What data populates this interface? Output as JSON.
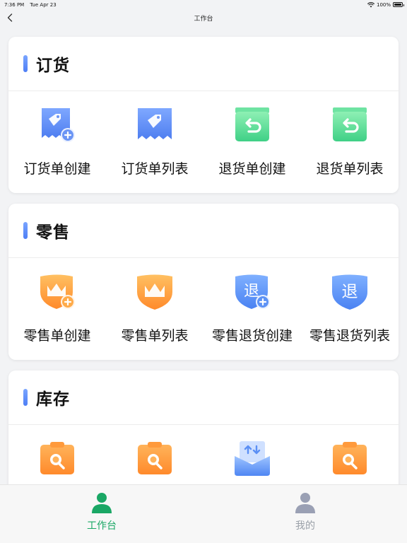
{
  "status_bar": {
    "time": "7:36 PM",
    "date": "Tue Apr 23",
    "battery": "100%"
  },
  "nav": {
    "title": "工作台",
    "back_icon": "chevron-left-icon"
  },
  "sections": [
    {
      "title": "订货",
      "items": [
        {
          "label": "订货单创建",
          "icon": "tag-receipt-add-icon"
        },
        {
          "label": "订货单列表",
          "icon": "tag-receipt-icon"
        },
        {
          "label": "退货单创建",
          "icon": "return-box-icon"
        },
        {
          "label": "退货单列表",
          "icon": "return-box-icon"
        }
      ]
    },
    {
      "title": "零售",
      "items": [
        {
          "label": "零售单创建",
          "icon": "crown-shield-add-icon"
        },
        {
          "label": "零售单列表",
          "icon": "crown-shield-icon"
        },
        {
          "label": "零售退货创建",
          "icon": "return-shield-add-icon",
          "glyph": "退"
        },
        {
          "label": "零售退货列表",
          "icon": "return-shield-icon",
          "glyph": "退"
        }
      ]
    },
    {
      "title": "库存",
      "items": [
        {
          "label": "",
          "icon": "clipboard-search-icon"
        },
        {
          "label": "",
          "icon": "clipboard-search-icon"
        },
        {
          "label": "",
          "icon": "inbox-transfer-icon"
        },
        {
          "label": "",
          "icon": "clipboard-search-icon"
        }
      ]
    }
  ],
  "tabs": [
    {
      "label": "工作台",
      "icon": "person-icon",
      "active": true
    },
    {
      "label": "我的",
      "icon": "person-icon",
      "active": false
    }
  ],
  "colors": {
    "accent": "#1aa765",
    "inactive": "#9aa0a8",
    "section_bar": "#5b8cf7"
  }
}
